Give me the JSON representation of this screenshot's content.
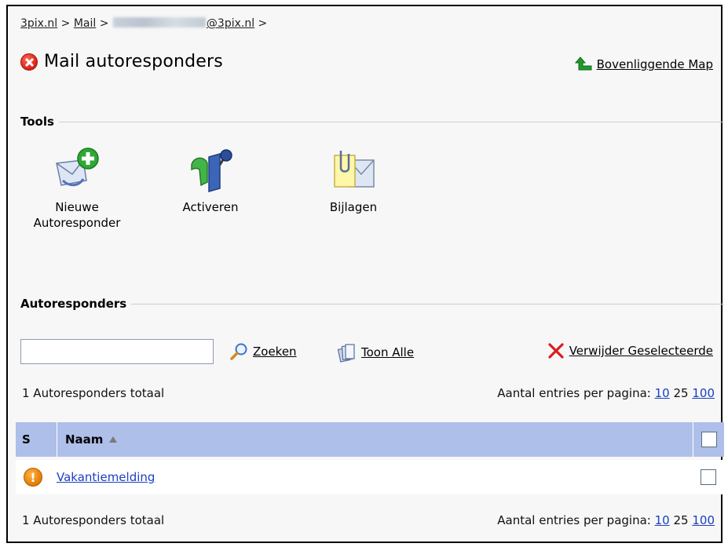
{
  "breadcrumb": {
    "item1": "3pix.nl",
    "sep": ">",
    "item2": "Mail",
    "item3_suffix": "@3pix.nl"
  },
  "page": {
    "title": "Mail autoresponders",
    "up_link": "Bovenliggende Map"
  },
  "tools": {
    "heading": "Tools",
    "items": [
      {
        "label_line1": "Nieuwe",
        "label_line2": "Autoresponder",
        "icon": "new-mail-icon"
      },
      {
        "label": "Activeren",
        "icon": "activate-icon"
      },
      {
        "label": "Bijlagen",
        "icon": "attachment-icon"
      }
    ]
  },
  "autoresponders": {
    "heading": "Autoresponders",
    "search": {
      "value": "",
      "placeholder": ""
    },
    "search_label": "Zoeken",
    "show_all_label": "Toon Alle",
    "delete_selected_label": "Verwijder Geselecteerde",
    "total_text": "1 Autoresponders totaal",
    "per_page_label": "Aantal entries per pagina:",
    "per_page_options": [
      "10",
      "25",
      "100"
    ],
    "columns": {
      "status": "S",
      "name": "Naam"
    },
    "rows": [
      {
        "name": "Vakantiemelding",
        "status_icon": "warning-icon"
      }
    ]
  },
  "colors": {
    "table_header": "#aebfe9",
    "link": "#1a3fbf",
    "error": "#d61f14",
    "warning": "#e27a00"
  }
}
